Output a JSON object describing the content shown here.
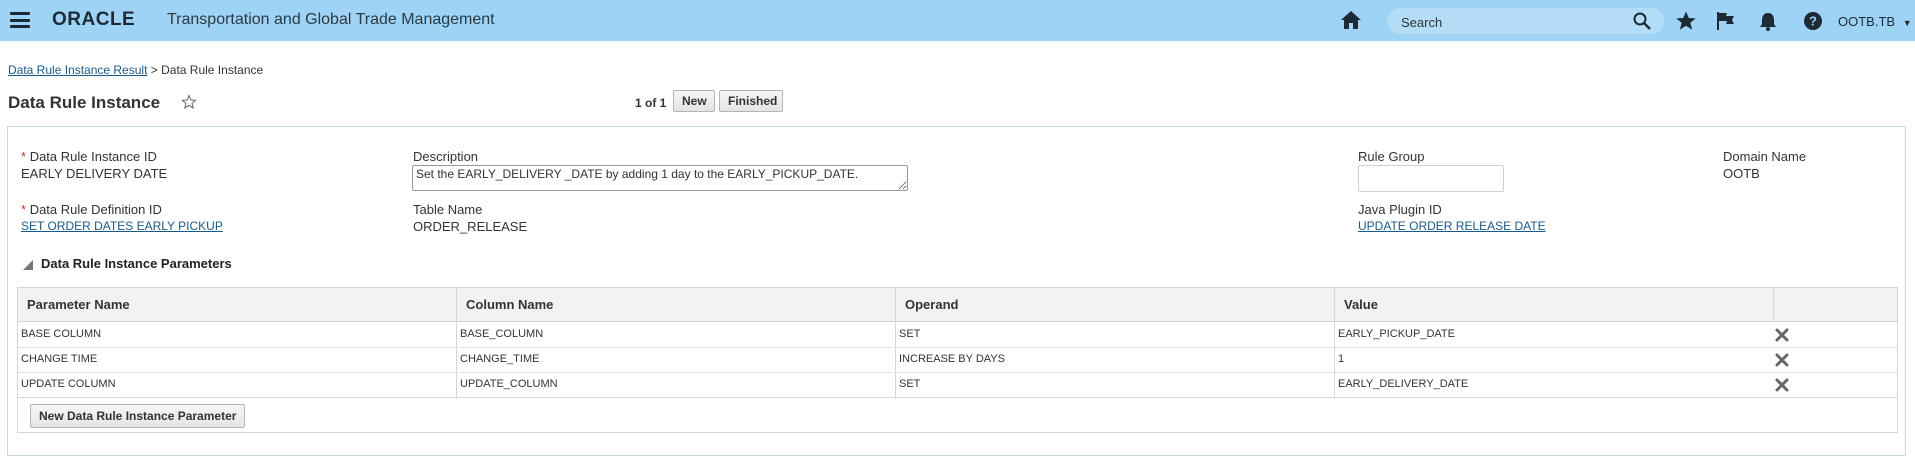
{
  "header": {
    "logo": "ORACLE",
    "app_title": "Transportation and Global Trade Management",
    "search_placeholder": "Search",
    "user": "OOTB.TB",
    "icons": [
      "menu-icon",
      "home-icon",
      "search-icon",
      "star-icon",
      "flag-icon",
      "bell-icon",
      "help-icon"
    ]
  },
  "breadcrumb": {
    "parent": "Data Rule Instance Result",
    "separator": ">",
    "current": "Data Rule Instance"
  },
  "page": {
    "title": "Data Rule Instance",
    "pager": "1 of 1",
    "new_label": "New",
    "finished_label": "Finished"
  },
  "form": {
    "instance_id_label": "Data Rule Instance ID",
    "instance_id_value": "EARLY DELIVERY DATE",
    "description_label": "Description",
    "description_value": "Set the EARLY_DELIVERY _DATE by adding 1 day to the EARLY_PICKUP_DATE.",
    "rule_group_label": "Rule Group",
    "rule_group_value": "",
    "domain_label": "Domain Name",
    "domain_value": "OOTB",
    "definition_id_label": "Data Rule Definition ID",
    "definition_id_value": "SET ORDER DATES EARLY PICKUP",
    "table_name_label": "Table Name",
    "table_name_value": "ORDER_RELEASE",
    "java_plugin_label": "Java Plugin ID",
    "java_plugin_value": "UPDATE ORDER RELEASE DATE",
    "required_marker": "*"
  },
  "parameters": {
    "section_title": "Data Rule Instance Parameters",
    "columns": [
      "Parameter Name",
      "Column Name",
      "Operand",
      "Value"
    ],
    "rows": [
      {
        "name": "BASE COLUMN",
        "column": "BASE_COLUMN",
        "operand": "SET",
        "value": "EARLY_PICKUP_DATE"
      },
      {
        "name": "CHANGE TIME",
        "column": "CHANGE_TIME",
        "operand": "INCREASE BY DAYS",
        "value": "1"
      },
      {
        "name": "UPDATE COLUMN",
        "column": "UPDATE_COLUMN",
        "operand": "SET",
        "value": "EARLY_DELIVERY_DATE"
      }
    ],
    "new_button_label": "New Data Rule Instance Parameter"
  },
  "colors": {
    "topbar": "#9fd3f6",
    "link": "#1a5a8a",
    "required": "#c0392b"
  }
}
